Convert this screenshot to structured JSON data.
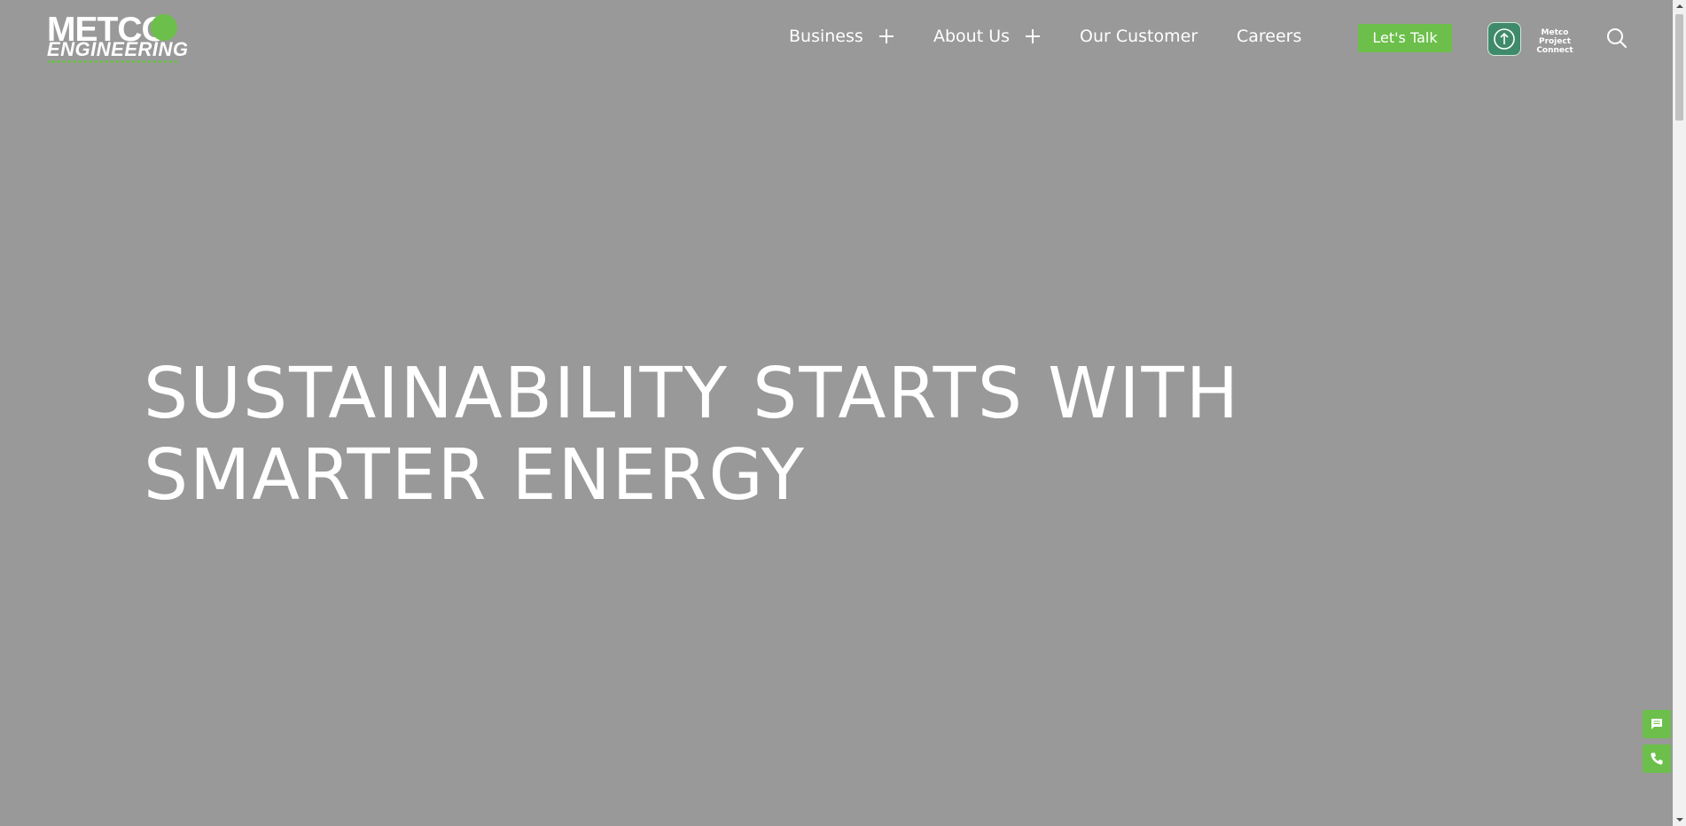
{
  "header": {
    "logo": {
      "brand": "METCO",
      "subbrand": "ENGINEERING"
    },
    "nav": [
      {
        "label": "Business",
        "has_submenu": true
      },
      {
        "label": "About Us",
        "has_submenu": true
      },
      {
        "label": "Our Customer",
        "has_submenu": false
      },
      {
        "label": "Careers",
        "has_submenu": false
      }
    ],
    "cta_label": "Let's Talk",
    "project_connect": {
      "line1": "Metco Project",
      "line2": "Connect",
      "icon": "upload-arrow-icon"
    },
    "search_icon": "search-icon"
  },
  "hero": {
    "line1": "SUSTAINABILITY STARTS WITH",
    "line2": "SMARTER ENERGY"
  },
  "floating": {
    "chat_icon": "chat-icon",
    "phone_icon": "phone-icon"
  },
  "colors": {
    "background": "#999999",
    "accent": "#6cbf4a",
    "text": "#ffffff",
    "connect_badge": "#3f8a6b"
  }
}
